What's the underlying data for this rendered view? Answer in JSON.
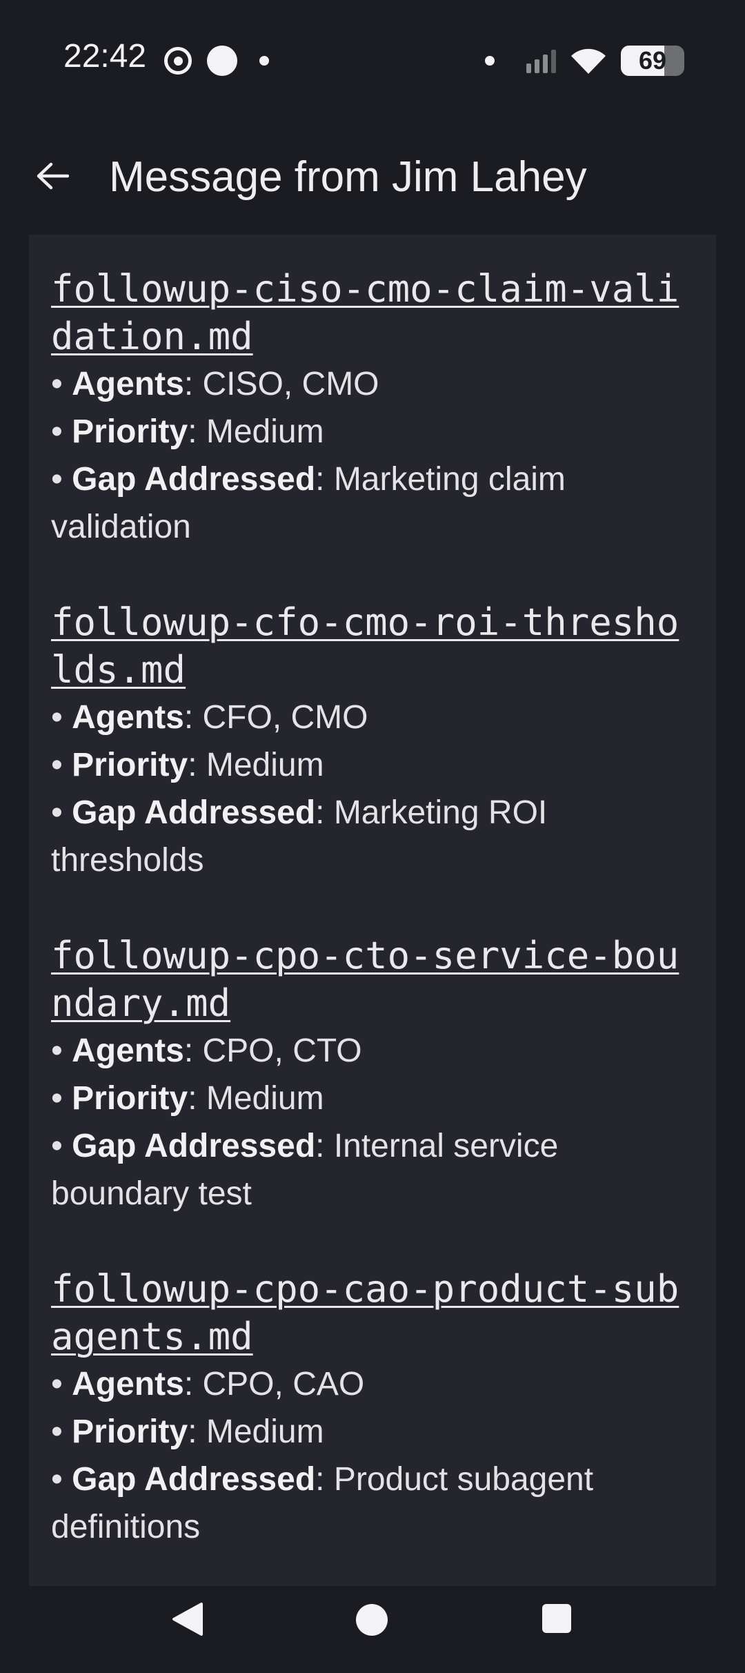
{
  "status_bar": {
    "time": "22:42",
    "battery_level": 69,
    "battery_label": "69",
    "icons_left": [
      "signal-app-icon",
      "white-dot-icon",
      "small-dot-icon"
    ],
    "icons_right": [
      "notification-dot-icon",
      "cell-signal-icon",
      "wifi-icon",
      "battery-icon"
    ]
  },
  "app_bar": {
    "back_icon": "arrow-left-icon",
    "title": "Message from Jim Lahey"
  },
  "message": {
    "entries": [
      {
        "filename": "followup-ciso-cmo-claim-validation.md",
        "agents_label": "Agents",
        "agents_value": ": CISO, CMO",
        "priority_label": "Priority",
        "priority_value": ": Medium",
        "gap_label": "Gap Addressed",
        "gap_value": ": Marketing claim validation"
      },
      {
        "filename": "followup-cfo-cmo-roi-thresholds.md",
        "agents_label": "Agents",
        "agents_value": ": CFO, CMO",
        "priority_label": "Priority",
        "priority_value": ": Medium",
        "gap_label": "Gap Addressed",
        "gap_value": ": Marketing ROI thresholds"
      },
      {
        "filename": "followup-cpo-cto-service-boundary.md",
        "agents_label": "Agents",
        "agents_value": ": CPO, CTO",
        "priority_label": "Priority",
        "priority_value": ": Medium",
        "gap_label": "Gap Addressed",
        "gap_value": ": Internal service boundary test"
      },
      {
        "filename": "followup-cpo-cao-product-subagents.md",
        "agents_label": "Agents",
        "agents_value": ": CPO, CAO",
        "priority_label": "Priority",
        "priority_value": ": Medium",
        "gap_label": "Gap Addressed",
        "gap_value": ": Product subagent definitions"
      }
    ],
    "bullet": "• "
  },
  "nav_bar": {
    "buttons": [
      "nav-back-icon",
      "nav-home-icon",
      "nav-recents-icon"
    ]
  },
  "colors": {
    "background": "#1b1c22",
    "card": "#24252d",
    "text": "#e8e8ea"
  }
}
